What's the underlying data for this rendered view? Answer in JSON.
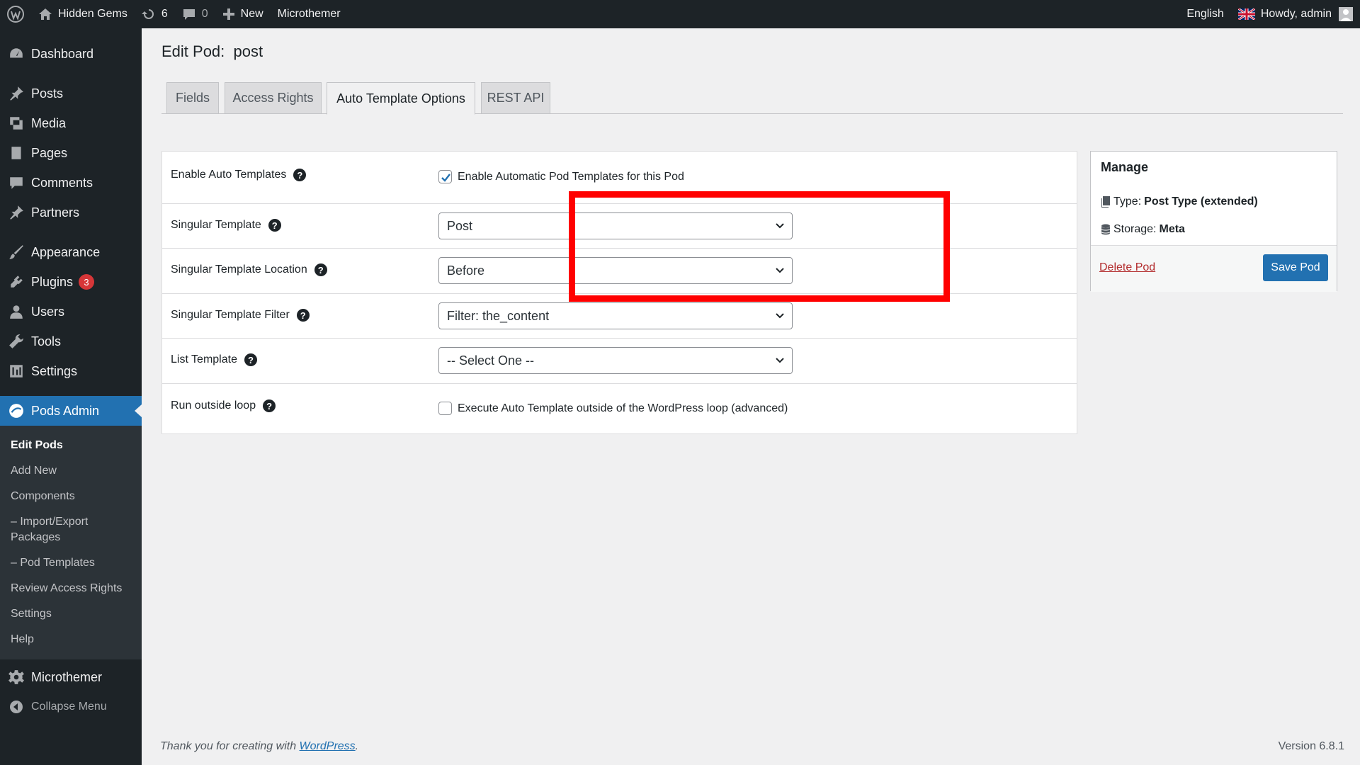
{
  "adminbar": {
    "site_name": "Hidden Gems",
    "updates_count": "6",
    "comments_count": "0",
    "new_label": "New",
    "microthemer_label": "Microthemer",
    "language": "English",
    "greeting": "Howdy, admin",
    "icons": [
      "wordpress-logo-icon",
      "home-icon",
      "updates-icon",
      "comment-icon",
      "plus-icon",
      "uk-flag-icon",
      "avatar-icon"
    ]
  },
  "sidebar": {
    "items": [
      {
        "label": "Dashboard",
        "icon": "dashboard-icon"
      },
      {
        "label": "Posts",
        "icon": "pin-icon"
      },
      {
        "label": "Media",
        "icon": "media-icon"
      },
      {
        "label": "Pages",
        "icon": "page-icon"
      },
      {
        "label": "Comments",
        "icon": "comment-icon"
      },
      {
        "label": "Partners",
        "icon": "pin-icon"
      },
      {
        "label": "Appearance",
        "icon": "brush-icon"
      },
      {
        "label": "Plugins",
        "icon": "plugin-icon",
        "badge": "3"
      },
      {
        "label": "Users",
        "icon": "user-icon"
      },
      {
        "label": "Tools",
        "icon": "wrench-icon"
      },
      {
        "label": "Settings",
        "icon": "settings-icon"
      },
      {
        "label": "Pods Admin",
        "icon": "pods-icon"
      }
    ],
    "submenu": [
      "Edit Pods",
      "Add New",
      "Components",
      "– Import/Export Packages",
      "– Pod Templates",
      "Review Access Rights",
      "Settings",
      "Help"
    ],
    "microthemer": "Microthemer",
    "collapse": "Collapse Menu"
  },
  "page": {
    "title": "Edit Pod:  post",
    "tabs": [
      "Fields",
      "Access Rights",
      "Auto Template Options",
      "REST API"
    ],
    "active_tab": "Auto Template Options"
  },
  "form": {
    "enable_auto": {
      "label": "Enable Auto Templates",
      "checkbox_label": "Enable Automatic Pod Templates for this Pod",
      "checked": true
    },
    "singular_template": {
      "label": "Singular Template",
      "value": "Post"
    },
    "singular_location": {
      "label": "Singular Template Location",
      "value": "Before"
    },
    "singular_filter": {
      "label": "Singular Template Filter",
      "value": "Filter: the_content"
    },
    "list_template": {
      "label": "List Template",
      "value": "-- Select One --"
    },
    "run_outside": {
      "label": "Run outside loop",
      "checkbox_label": "Execute Auto Template outside of the WordPress loop (advanced)",
      "checked": false
    },
    "help_glyph": "?"
  },
  "manage": {
    "title": "Manage",
    "type_label": "Type:",
    "type_value": "Post Type (extended)",
    "storage_label": "Storage:",
    "storage_value": "Meta",
    "delete_label": "Delete Pod",
    "save_label": "Save Pod"
  },
  "footer": {
    "thanks_prefix": "Thank you for creating with ",
    "thanks_link": "WordPress",
    "thanks_suffix": ".",
    "version": "Version 6.8.1"
  },
  "colors": {
    "accent": "#2271b1",
    "sidebar_bg": "#1d2327",
    "highlight": "#ff0000",
    "danger": "#b32d2e"
  }
}
